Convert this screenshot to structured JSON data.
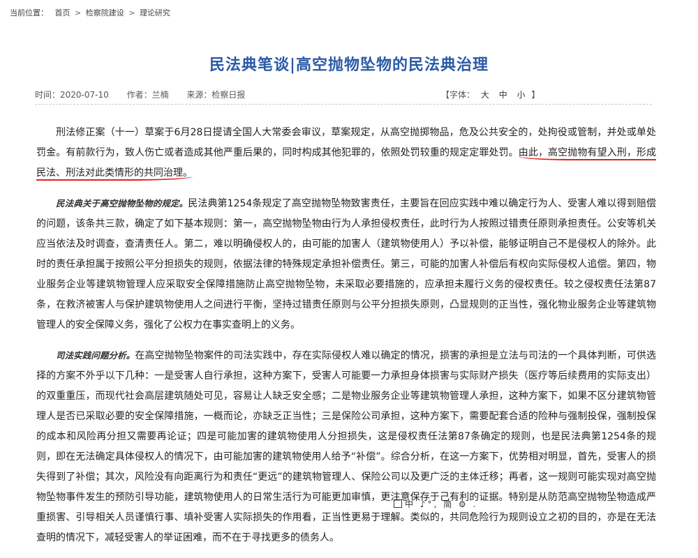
{
  "breadcrumb": {
    "prefix": "当前位置：",
    "items": [
      "首页",
      "检察院建设",
      "理论研究"
    ],
    "separator": ">"
  },
  "article": {
    "title": "民法典笔谈|高空抛物坠物的民法典治理",
    "meta": {
      "time": "时间：2020-07-10",
      "author": "作者：兰楠",
      "source": "来源：检察日报"
    },
    "font_size": {
      "open": "【字体：",
      "options": [
        "大",
        "中",
        "小"
      ],
      "close": "】"
    },
    "p1_text": "刑法修正案（十一）草案于6月28日提请全国人大常委会审议，草案规定，从高空抛掷物品，危及公共安全的，处拘役或管制，并处或单处罚金。有前款行为，致人伤亡或者造成其他严重后果的，同时构成其他犯罪的，依照处罚较重的规定定罪处罚。",
    "p1_highlight": "由此，高空抛物有望入刑，形成民法、刑法对此类情形的共同治理。",
    "p2_lead": "民法典关于高空抛物坠物的规定。",
    "p2_text": "民法典第1254条规定了高空抛物坠物致害责任，主要旨在回应实践中难以确定行为人、受害人难以得到赔偿的问题，该条共三款，确定了如下基本规则：第一，高空抛物坠物由行为人承担侵权责任，此时行为人按照过错责任原则承担责任。公安等机关应当依法及时调查，查清责任人。第二，难以明确侵权人的，由可能的加害人（建筑物使用人）予以补偿，能够证明自己不是侵权人的除外。此时的责任承担属于按照公平分担损失的规则，依据法律的特殊规定承担补偿责任。第三，可能的加害人补偿后有权向实际侵权人追偿。第四，物业服务企业等建筑物管理人应采取安全保障措施防止高空抛物坠物，未采取必要措施的，应承担未履行义务的侵权责任。较之侵权责任法第87条，在救济被害人与保护建筑物使用人之间进行平衡，坚持过错责任原则与公平分担损失原则，凸显规则的正当性，强化物业服务企业等建筑物管理人的安全保障义务，强化了公权力在事实查明上的义务。",
    "p3_lead": "司法实践问题分析。",
    "p3_text": "在高空抛物坠物案件的司法实践中，存在实际侵权人难以确定的情况，损害的承担是立法与司法的一个具体判断，可供选择的方案不外乎以下几种：一是受害人自行承担，这种方案下，受害人可能要一力承担身体损害与实际财产损失（医疗等后续费用的实际支出）的双重重压，而现代社会高层建筑随处可见，容易让人缺乏安全感；二是物业服务企业等建筑物管理人承担，这种方案下，如果不区分建筑物管理人是否已采取必要的安全保障措施，一概而论，亦缺乏正当性；三是保险公司承担，这种方案下，需要配套合适的险种与强制投保，强制投保的成本和风险再分担又需要再论证；四是可能加害的建筑物使用人分担损失，这是侵权责任法第87条确定的规则，也是民法典第1254条的规则，即在无法确定具体侵权人的情况下，由可能加害的建筑物使用人给予“补偿”。综合分析，在这一方案下，优势相对明显，首先，受害人的损失得到了补偿；其次，风险没有向距离行为和责任“更远”的建筑物管理人、保险公司以及更广泛的主体迁移；再者，这一规则可能实现对高空抛物坠物事件发生的预防引导功能，建筑物使用人的日常生活行为可能更加审慎，更注意保存于己有利的证据。特别是从防范高空抛物坠物造成严重损害、引导相关人员谨慎行事、填补受害人实际损失的作用看，正当性更易于理解。类似的，共同危险行为规则设立之初的目的，亦是在无法查明的情况下，减轻受害人的举证困难，而不在于寻找更多的债务人。"
  },
  "toolbar": {
    "text": "中 ♪°, 简 ⚙ ."
  },
  "colors": {
    "title": "#2b5aa6",
    "underline_annotation": "#e0201b"
  }
}
